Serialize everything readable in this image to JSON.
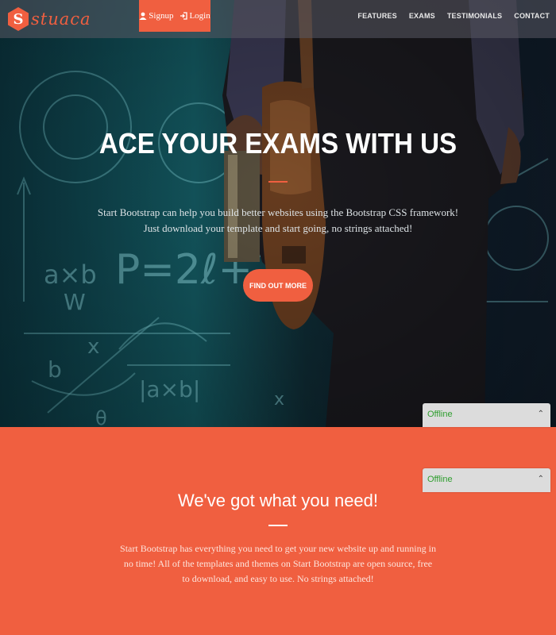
{
  "nav": {
    "logo_letter": "S",
    "logo_text": "stuaca",
    "signup_label": "Signup",
    "login_label": "Login",
    "menu": [
      "FEATURES",
      "EXAMS",
      "TESTIMONIALS",
      "CONTACT"
    ]
  },
  "hero": {
    "title": "ACE YOUR EXAMS WITH US",
    "subtitle_line1": "Start Bootstrap can help you build better websites using the Bootstrap CSS framework!",
    "subtitle_line2": "Just download your template and start going, no strings attached!",
    "button_label": "FIND OUT MORE"
  },
  "section": {
    "title": "We've got what you need!",
    "text": "Start Bootstrap has everything you need to get your new website up and running in no time! All of the templates and themes on Start Bootstrap are open source, free to download, and easy to use. No strings attached!"
  },
  "chat_widgets": [
    {
      "status": "Offline",
      "icon": "chevron-up-icon"
    },
    {
      "status": "Offline",
      "icon": "chevron-up-icon"
    }
  ],
  "colors": {
    "accent": "#f05f40",
    "offline": "#2e9e2e"
  }
}
